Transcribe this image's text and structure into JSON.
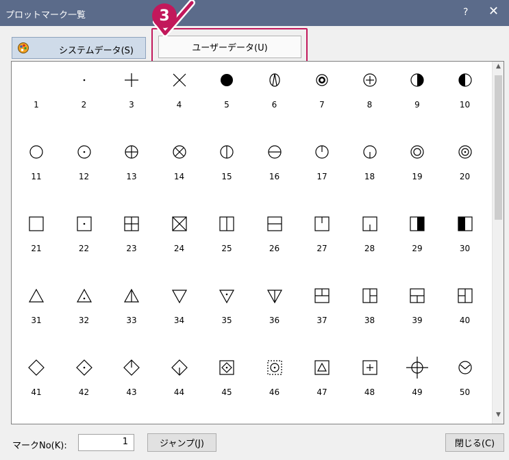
{
  "window": {
    "title": "プロットマーク一覧",
    "help": "?",
    "close": "✕"
  },
  "tabs": {
    "system": "システムデータ(S)",
    "user": "ユーザーデータ(U)"
  },
  "annotation": {
    "step": "3"
  },
  "marks": [
    "1",
    "2",
    "3",
    "4",
    "5",
    "6",
    "7",
    "8",
    "9",
    "10",
    "11",
    "12",
    "13",
    "14",
    "15",
    "16",
    "17",
    "18",
    "19",
    "20",
    "21",
    "22",
    "23",
    "24",
    "25",
    "26",
    "27",
    "28",
    "29",
    "30",
    "31",
    "32",
    "33",
    "34",
    "35",
    "36",
    "37",
    "38",
    "39",
    "40",
    "41",
    "42",
    "43",
    "44",
    "45",
    "46",
    "47",
    "48",
    "49",
    "50"
  ],
  "scroll": {
    "up": "▲",
    "down": "▼"
  },
  "footer": {
    "mark_label": "マークNo(K):",
    "mark_value": "1",
    "jump": "ジャンプ(J)",
    "close": "閉じる(C)"
  },
  "colors": {
    "titlebar": "#5b6b8a",
    "highlight": "#c2185b"
  }
}
